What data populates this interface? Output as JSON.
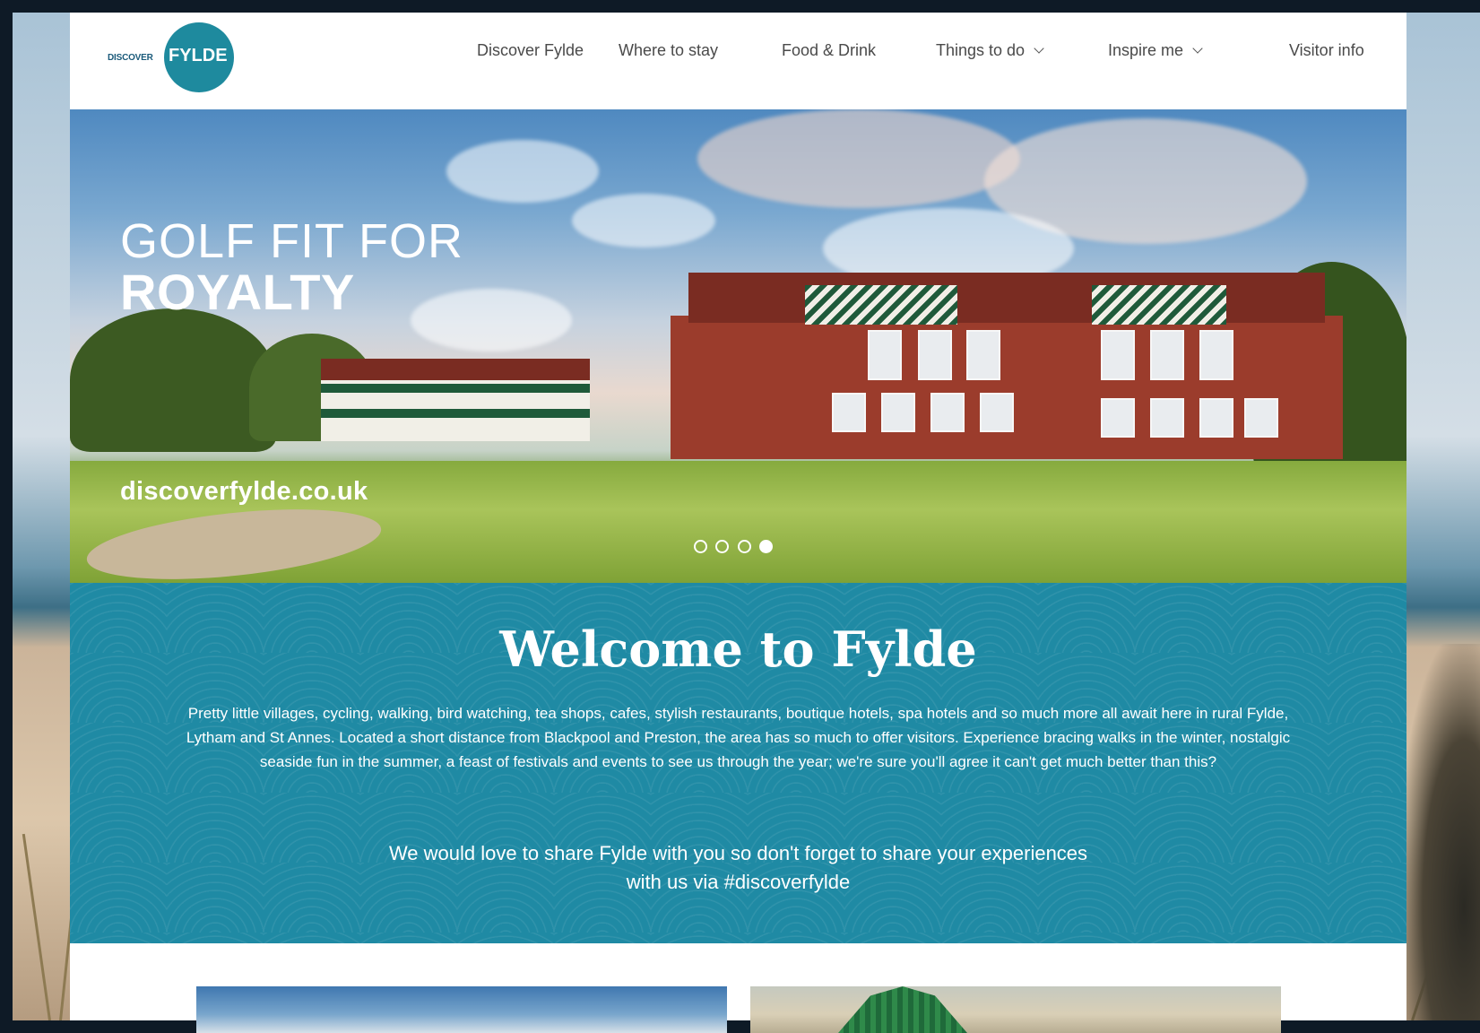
{
  "brand": {
    "logo_small": "DISCOVER",
    "logo_big": "FYLDE",
    "accent_color": "#1e8a9e"
  },
  "nav": {
    "items": [
      {
        "label": "Discover Fylde",
        "has_dropdown": false
      },
      {
        "label": "Where to stay",
        "has_dropdown": false
      },
      {
        "label": "Food & Drink",
        "has_dropdown": false
      },
      {
        "label": "Things to do",
        "has_dropdown": true
      },
      {
        "label": "Inspire me",
        "has_dropdown": true
      },
      {
        "label": "Visitor info",
        "has_dropdown": false
      }
    ]
  },
  "hero": {
    "title_line1": "GOLF FIT FOR",
    "title_line2": "ROYALTY",
    "url": "discoverfylde.co.uk",
    "slide_count": 4,
    "active_slide": 4
  },
  "welcome": {
    "title": "Welcome to Fylde",
    "body": "Pretty little villages, cycling, walking, bird watching, tea shops, cafes, stylish restaurants, boutique hotels, spa hotels and so much more all await here in rural Fylde, Lytham and St Annes. Located a short distance from Blackpool and Preston, the area has so much to offer visitors. Experience bracing walks in the winter, nostalgic seaside fun in the summer, a feast of festivals and events to see us through the year; we're sure you'll agree it can't get much better than this?",
    "share": "We would love to share Fylde with you so don't forget to share your experiences with us via #discoverfylde",
    "background_color": "#1f8aa4"
  }
}
